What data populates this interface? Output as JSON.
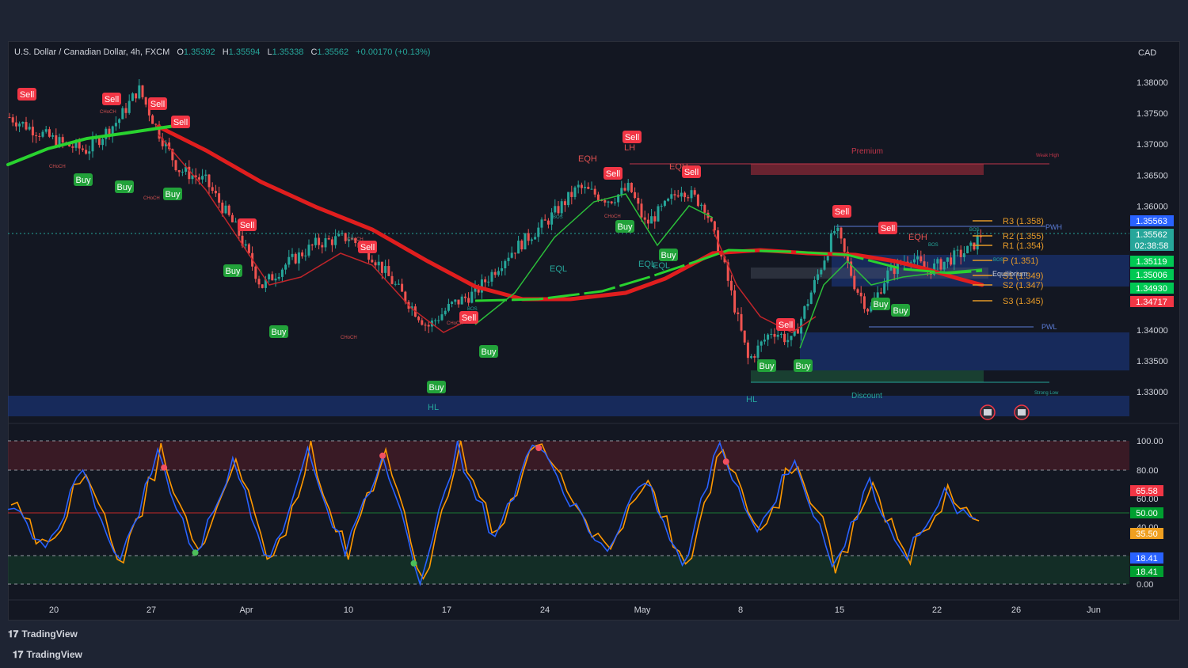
{
  "header": {
    "symbol": "U.S. Dollar / Canadian Dollar, 4h, FXCM",
    "o_label": "O",
    "o_val": "1.35392",
    "h_label": "H",
    "h_val": "1.35594",
    "l_label": "L",
    "l_val": "1.35338",
    "c_label": "C",
    "c_val": "1.35562",
    "change": "+0.00170 (+0.13%)"
  },
  "currency": "CAD",
  "price_axis": {
    "ticks": [
      "1.38000",
      "1.37500",
      "1.37000",
      "1.36500",
      "1.36000",
      "1.35500",
      "1.35000",
      "1.34500",
      "1.34000",
      "1.33500",
      "1.33000"
    ],
    "ticks_visible": [
      "1.38000",
      "1.37500",
      "1.37000",
      "1.36500",
      "1.36000",
      "1.34000",
      "1.33500",
      "1.33000"
    ],
    "badges": [
      {
        "text": "1.35563",
        "color": "#2962ff"
      },
      {
        "text": "1.35562",
        "color": "#26a69a"
      },
      {
        "text": "02:38:58",
        "color": "#26a69a"
      },
      {
        "text": "1.35119",
        "color": "#00c853"
      },
      {
        "text": "1.35006",
        "color": "#00c853"
      },
      {
        "text": "1.34930",
        "color": "#00c853"
      },
      {
        "text": "1.34717",
        "color": "#f23645"
      }
    ]
  },
  "osc_axis": {
    "ticks": [
      "100.00",
      "80.00",
      "60.00",
      "40.00",
      "0.00"
    ],
    "badges": [
      {
        "text": "65.58",
        "color": "#f23645"
      },
      {
        "text": "50.00",
        "color": "#00a030"
      },
      {
        "text": "35.50",
        "color": "#f0a020"
      },
      {
        "text": "18.41",
        "color": "#2962ff"
      },
      {
        "text": "18.41",
        "color": "#00a030"
      }
    ]
  },
  "time_axis": [
    "20",
    "27",
    "Apr",
    "10",
    "17",
    "24",
    "May",
    "8",
    "15",
    "22",
    "26",
    "Jun"
  ],
  "labels": {
    "pivots": [
      "R3 (1.358)",
      "R2 (1.355)",
      "R1 (1.354)",
      "P (1.351)",
      "S1 (1.349)",
      "S2 (1.347)",
      "S3 (1.345)"
    ],
    "zones": {
      "premium": "Premium",
      "discount": "Discount",
      "equilibrium": "Equilibrium",
      "weak_high": "Weak High",
      "strong_low": "Strong Low",
      "pwh": "PWH",
      "pwl": "PWL"
    },
    "structure": [
      "EQH",
      "EQH",
      "EQH",
      "EQH",
      "LH",
      "EQL",
      "EQL",
      "EQL",
      "HL",
      "HL",
      "BOS",
      "CHoCH"
    ],
    "sell": "Sell",
    "buy": "Buy"
  },
  "footer": {
    "brand1": "TradingView",
    "brand2": "TradingView"
  },
  "colors": {
    "bull": "#26a69a",
    "bear": "#ef5350",
    "ema_red": "#e01e1e",
    "ema_green": "#29d32f",
    "k_line": "#2962ff",
    "d_line": "#ff9800"
  },
  "chart_data": [
    {
      "type": "candlestick",
      "title": "U.S. Dollar / Canadian Dollar, 4h, FXCM",
      "ylabel": "CAD",
      "ylim": [
        1.3275,
        1.3825
      ],
      "x": [
        "Mar 20",
        "Mar 27",
        "Apr 3",
        "Apr 10",
        "Apr 17",
        "Apr 24",
        "May 1",
        "May 8",
        "May 15",
        "May 22",
        "May 24"
      ],
      "close": [
        1.3745,
        1.371,
        1.3625,
        1.3555,
        1.3415,
        1.357,
        1.362,
        1.335,
        1.354,
        1.351,
        1.3556
      ],
      "last": {
        "open": 1.35392,
        "high": 1.35594,
        "low": 1.35338,
        "close": 1.35562
      },
      "pivot_levels": {
        "R3": 1.358,
        "R2": 1.355,
        "R1": 1.354,
        "P": 1.351,
        "S1": 1.349,
        "S2": 1.347,
        "S3": 1.345
      }
    },
    {
      "type": "line",
      "series": [
        {
          "name": "%K",
          "values": [
            55,
            25,
            80,
            15,
            90,
            20,
            85,
            15,
            95,
            20,
            90,
            5,
            95,
            30,
            100,
            60,
            20,
            75,
            10,
            100,
            35,
            90,
            10,
            70,
            20,
            65,
            35
          ]
        }
      ],
      "ylim": [
        0,
        100
      ]
    }
  ]
}
